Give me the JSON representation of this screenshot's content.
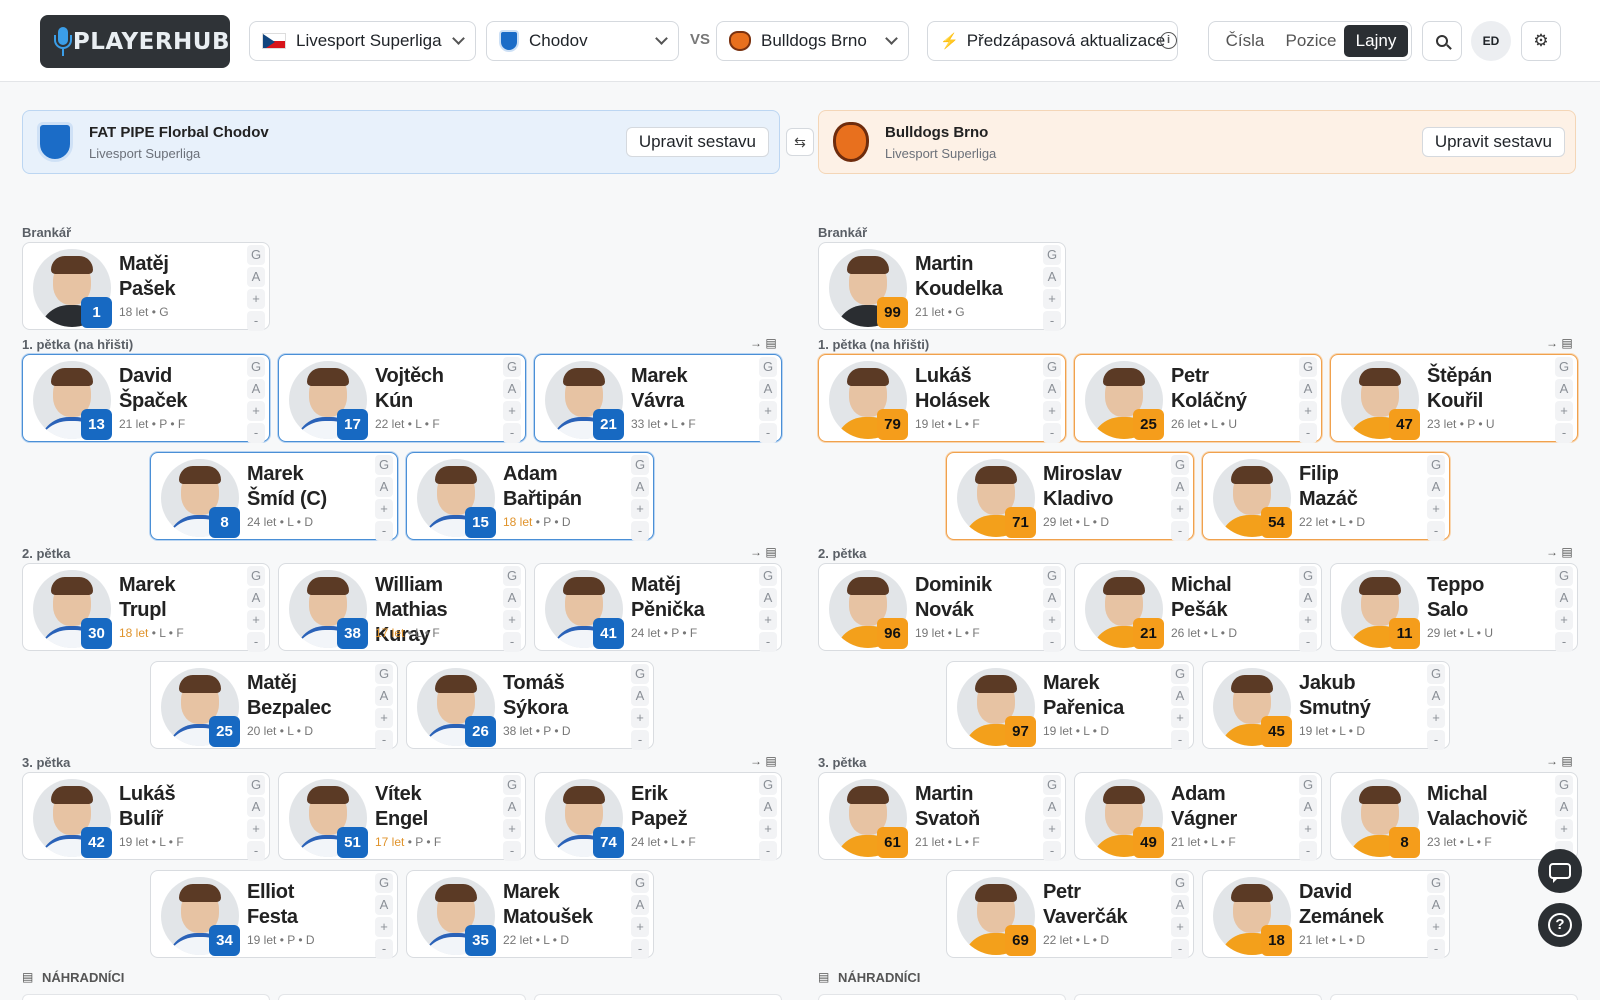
{
  "header": {
    "logo_text": "PLAYERHUB",
    "league_select": "Livesport Superliga",
    "home_select": "Chodov",
    "vs": "VS",
    "away_select": "Bulldogs Brno",
    "update_label": "Předzápasová aktualizace",
    "view_tabs": [
      "Čísla",
      "Pozice",
      "Lajny"
    ],
    "active_tab": "Lajny",
    "user_initials": "ED"
  },
  "home": {
    "name": "FAT PIPE Florbal Chodov",
    "league": "Livesport Superliga",
    "edit_label": "Upravit sestavu",
    "goalie_label": "Brankář",
    "goalie": {
      "first": "Matěj",
      "last": "Pašek",
      "number": "1",
      "age": "18 let",
      "meta": " • G",
      "young": false
    },
    "lines": [
      {
        "label": "1. pětka (na hřišti)",
        "players": [
          {
            "first": "David",
            "last": "Špaček",
            "number": "13",
            "age": "21 let",
            "meta": " • P • F",
            "young": false
          },
          {
            "first": "Vojtěch",
            "last": "Kún",
            "number": "17",
            "age": "22 let",
            "meta": " • L • F",
            "young": false
          },
          {
            "first": "Marek",
            "last": "Vávra",
            "number": "21",
            "age": "33 let",
            "meta": " • L • F",
            "young": false
          },
          {
            "first": "Marek",
            "last": "Šmíd (C)",
            "number": "8",
            "age": "24 let",
            "meta": " • L • D",
            "young": false
          },
          {
            "first": "Adam",
            "last": "Bařtipán",
            "number": "15",
            "age": "18 let",
            "meta": " • P • D",
            "young": true
          }
        ]
      },
      {
        "label": "2. pětka",
        "players": [
          {
            "first": "Marek",
            "last": "Trupl",
            "number": "30",
            "age": "18 let",
            "meta": " • L • F",
            "young": true
          },
          {
            "first": "William",
            "last": "Mathias Kuray",
            "number": "38",
            "age": "17 let",
            "meta": " • L • F",
            "young": true
          },
          {
            "first": "Matěj",
            "last": "Pěnička",
            "number": "41",
            "age": "24 let",
            "meta": " • P • F",
            "young": false
          },
          {
            "first": "Matěj",
            "last": "Bezpalec",
            "number": "25",
            "age": "20 let",
            "meta": " • L • D",
            "young": false
          },
          {
            "first": "Tomáš",
            "last": "Sýkora",
            "number": "26",
            "age": "38 let",
            "meta": " • P • D",
            "young": false
          }
        ]
      },
      {
        "label": "3. pětka",
        "players": [
          {
            "first": "Lukáš",
            "last": "Bulíř",
            "number": "42",
            "age": "19 let",
            "meta": " • L • F",
            "young": false
          },
          {
            "first": "Vítek",
            "last": "Engel",
            "number": "51",
            "age": "17 let",
            "meta": " • P • F",
            "young": true
          },
          {
            "first": "Erik",
            "last": "Papež",
            "number": "74",
            "age": "24 let",
            "meta": " • L • F",
            "young": false
          },
          {
            "first": "Elliot",
            "last": "Festa",
            "number": "34",
            "age": "19 let",
            "meta": " • P • D",
            "young": false
          },
          {
            "first": "Marek",
            "last": "Matoušek",
            "number": "35",
            "age": "22 let",
            "meta": " • L • D",
            "young": false
          }
        ]
      }
    ],
    "bench_label": "NÁHRADNÍCI"
  },
  "away": {
    "name": "Bulldogs Brno",
    "league": "Livesport Superliga",
    "edit_label": "Upravit sestavu",
    "goalie_label": "Brankář",
    "goalie": {
      "first": "Martin",
      "last": "Koudelka",
      "number": "99",
      "age": "21 let",
      "meta": " • G",
      "young": false
    },
    "lines": [
      {
        "label": "1. pětka (na hřišti)",
        "players": [
          {
            "first": "Lukáš",
            "last": "Holásek",
            "number": "79",
            "age": "19 let",
            "meta": " • L • F",
            "young": false
          },
          {
            "first": "Petr",
            "last": "Koláčný",
            "number": "25",
            "age": "26 let",
            "meta": " • L • U",
            "young": false
          },
          {
            "first": "Štěpán",
            "last": "Kouřil",
            "number": "47",
            "age": "23 let",
            "meta": " • P • U",
            "young": false
          },
          {
            "first": "Miroslav",
            "last": "Kladivo",
            "number": "71",
            "age": "29 let",
            "meta": " • L • D",
            "young": false
          },
          {
            "first": "Filip",
            "last": "Mazáč",
            "number": "54",
            "age": "22 let",
            "meta": " • L • D",
            "young": false
          }
        ]
      },
      {
        "label": "2. pětka",
        "players": [
          {
            "first": "Dominik",
            "last": "Novák",
            "number": "96",
            "age": "19 let",
            "meta": " • L • F",
            "young": false
          },
          {
            "first": "Michal",
            "last": "Pešák",
            "number": "21",
            "age": "26 let",
            "meta": " • L • D",
            "young": false
          },
          {
            "first": "Teppo",
            "last": "Salo",
            "number": "11",
            "age": "29 let",
            "meta": " • L • U",
            "young": false
          },
          {
            "first": "Marek",
            "last": "Pařenica",
            "number": "97",
            "age": "19 let",
            "meta": " • L • D",
            "young": false
          },
          {
            "first": "Jakub",
            "last": "Smutný",
            "number": "45",
            "age": "19 let",
            "meta": " • L • D",
            "young": false
          }
        ]
      },
      {
        "label": "3. pětka",
        "players": [
          {
            "first": "Martin",
            "last": "Svatoň",
            "number": "61",
            "age": "21 let",
            "meta": " • L • F",
            "young": false
          },
          {
            "first": "Adam",
            "last": "Vágner",
            "number": "49",
            "age": "21 let",
            "meta": " • L • F",
            "young": false
          },
          {
            "first": "Michal",
            "last": "Valachovič",
            "number": "8",
            "age": "23 let",
            "meta": " • L • F",
            "young": false
          },
          {
            "first": "Petr",
            "last": "Vaverčák",
            "number": "69",
            "age": "22 let",
            "meta": " • L • D",
            "young": false
          },
          {
            "first": "David",
            "last": "Zemánek",
            "number": "18",
            "age": "21 let",
            "meta": " • L • D",
            "young": false
          }
        ]
      }
    ],
    "bench_label": "NÁHRADNÍCI"
  },
  "stat_buttons": [
    "G",
    "A",
    "+",
    "-"
  ],
  "colors": {
    "home_accent": "#1769c2",
    "away_accent": "#f59d1b",
    "young_age": "#e0932b"
  }
}
